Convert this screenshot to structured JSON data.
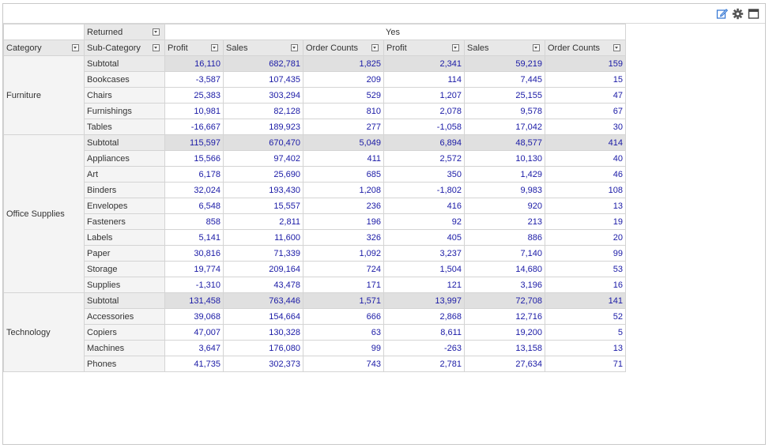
{
  "toolbar": {
    "icons": [
      "edit-icon",
      "gear-icon",
      "maximize-icon"
    ],
    "accent_color": "#3a7bd5"
  },
  "pivot": {
    "column_field_label": "Returned",
    "column_group_label": "Yes",
    "row_headers": [
      "Category",
      "Sub-Category"
    ],
    "measure_headers": [
      "Profit",
      "Sales",
      "Order Counts",
      "Profit",
      "Sales",
      "Order Counts"
    ],
    "value_color": "#1a1aa6",
    "groups": [
      {
        "category": "Furniture",
        "rows": [
          {
            "sub": "Subtotal",
            "values": [
              "16,110",
              "682,781",
              "1,825",
              "2,341",
              "59,219",
              "159"
            ]
          },
          {
            "sub": "Bookcases",
            "values": [
              "-3,587",
              "107,435",
              "209",
              "114",
              "7,445",
              "15"
            ]
          },
          {
            "sub": "Chairs",
            "values": [
              "25,383",
              "303,294",
              "529",
              "1,207",
              "25,155",
              "47"
            ]
          },
          {
            "sub": "Furnishings",
            "values": [
              "10,981",
              "82,128",
              "810",
              "2,078",
              "9,578",
              "67"
            ]
          },
          {
            "sub": "Tables",
            "values": [
              "-16,667",
              "189,923",
              "277",
              "-1,058",
              "17,042",
              "30"
            ]
          }
        ]
      },
      {
        "category": "Office Supplies",
        "rows": [
          {
            "sub": "Subtotal",
            "values": [
              "115,597",
              "670,470",
              "5,049",
              "6,894",
              "48,577",
              "414"
            ]
          },
          {
            "sub": "Appliances",
            "values": [
              "15,566",
              "97,402",
              "411",
              "2,572",
              "10,130",
              "40"
            ]
          },
          {
            "sub": "Art",
            "values": [
              "6,178",
              "25,690",
              "685",
              "350",
              "1,429",
              "46"
            ]
          },
          {
            "sub": "Binders",
            "values": [
              "32,024",
              "193,430",
              "1,208",
              "-1,802",
              "9,983",
              "108"
            ]
          },
          {
            "sub": "Envelopes",
            "values": [
              "6,548",
              "15,557",
              "236",
              "416",
              "920",
              "13"
            ]
          },
          {
            "sub": "Fasteners",
            "values": [
              "858",
              "2,811",
              "196",
              "92",
              "213",
              "19"
            ]
          },
          {
            "sub": "Labels",
            "values": [
              "5,141",
              "11,600",
              "326",
              "405",
              "886",
              "20"
            ]
          },
          {
            "sub": "Paper",
            "values": [
              "30,816",
              "71,339",
              "1,092",
              "3,237",
              "7,140",
              "99"
            ]
          },
          {
            "sub": "Storage",
            "values": [
              "19,774",
              "209,164",
              "724",
              "1,504",
              "14,680",
              "53"
            ]
          },
          {
            "sub": "Supplies",
            "values": [
              "-1,310",
              "43,478",
              "171",
              "121",
              "3,196",
              "16"
            ]
          }
        ]
      },
      {
        "category": "Technology",
        "rows": [
          {
            "sub": "Subtotal",
            "values": [
              "131,458",
              "763,446",
              "1,571",
              "13,997",
              "72,708",
              "141"
            ]
          },
          {
            "sub": "Accessories",
            "values": [
              "39,068",
              "154,664",
              "666",
              "2,868",
              "12,716",
              "52"
            ]
          },
          {
            "sub": "Copiers",
            "values": [
              "47,007",
              "130,328",
              "63",
              "8,611",
              "19,200",
              "5"
            ]
          },
          {
            "sub": "Machines",
            "values": [
              "3,647",
              "176,080",
              "99",
              "-263",
              "13,158",
              "13"
            ]
          },
          {
            "sub": "Phones",
            "values": [
              "41,735",
              "302,373",
              "743",
              "2,781",
              "27,634",
              "71"
            ]
          }
        ]
      }
    ]
  }
}
